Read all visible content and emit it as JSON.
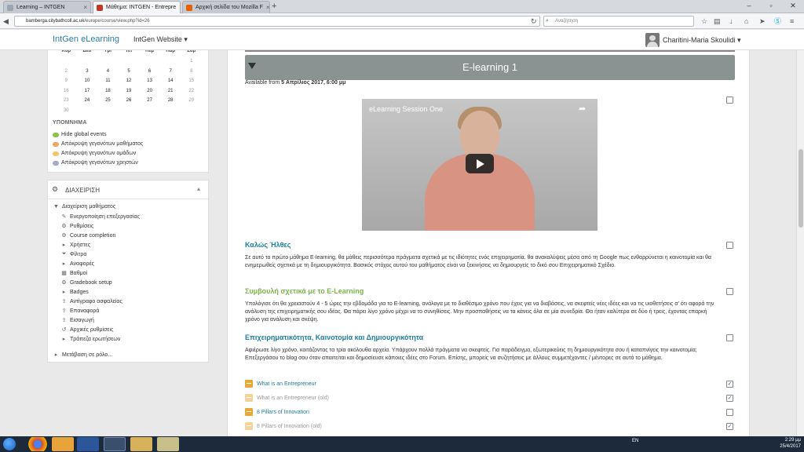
{
  "browser": {
    "tabs": [
      {
        "label": "Learning – INTGEN",
        "favicon_color": "#9aa6b3"
      },
      {
        "label": "Μάθημα: INTGEN - Entrepre",
        "favicon_color": "#c0392b"
      },
      {
        "label": "Αρχική σελίδα του Mozilla F",
        "favicon_color": "#e66000"
      }
    ],
    "url_host": "bamberga.citybathcoll.ac.uk",
    "url_path": "/europe/course/view.php?id=26",
    "search_placeholder": "Αναζήτηση"
  },
  "header": {
    "brand": "IntGen eLearning",
    "site_menu": "IntGen Website",
    "user_name": "Charitini-Maria Skoulidi"
  },
  "calendar": {
    "weekdays": [
      "Κυρ",
      "Δευ",
      "Τρι",
      "Τετ",
      "Πεμ",
      "Παρ",
      "Σαβ"
    ],
    "weeks": [
      [
        "",
        "",
        "",
        "",
        "",
        "",
        "1"
      ],
      [
        "2",
        "3",
        "4",
        "5",
        "6",
        "7",
        "8"
      ],
      [
        "9",
        "10",
        "11",
        "12",
        "13",
        "14",
        "15"
      ],
      [
        "16",
        "17",
        "18",
        "19",
        "20",
        "21",
        "22"
      ],
      [
        "23",
        "24",
        "25",
        "26",
        "27",
        "28",
        "29"
      ],
      [
        "30",
        "",
        "",
        "",
        "",
        "",
        ""
      ]
    ],
    "legend_title": "ΥΠΟΜΝΗΜΑ",
    "legend": [
      {
        "label": "Hide global events",
        "color": "#8bc34a"
      },
      {
        "label": "Απόκρυψη γεγονότων μαθήματος",
        "color": "#f0a860"
      },
      {
        "label": "Απόκρυψη γεγονότων ομάδων",
        "color": "#f6c46a"
      },
      {
        "label": "Απόκρυψη γεγονότων χρηστών",
        "color": "#a3a9c9"
      }
    ]
  },
  "admin": {
    "title": "ΔΙΑΧΕΙΡΙΣΗ",
    "course_admin": "Διαχείριση μαθήματος",
    "items": [
      {
        "label": "Ενεργοποίηση επεξεργασίας",
        "icon": "pencil-icon"
      },
      {
        "label": "Ρυθμίσεις",
        "icon": "gear-icon"
      },
      {
        "label": "Course completion",
        "icon": "gear-icon"
      },
      {
        "label": "Χρήστες",
        "icon": "caret-right-icon"
      },
      {
        "label": "Φίλτρα",
        "icon": "filter-icon"
      },
      {
        "label": "Αναφορές",
        "icon": "caret-right-icon"
      },
      {
        "label": "Βαθμοί",
        "icon": "grades-icon"
      },
      {
        "label": "Gradebook setup",
        "icon": "gear-icon"
      },
      {
        "label": "Badges",
        "icon": "caret-right-icon"
      },
      {
        "label": "Αντίγραφο ασφαλείας",
        "icon": "upload-icon"
      },
      {
        "label": "Επαναφορά",
        "icon": "upload-icon"
      },
      {
        "label": "Εισαγωγή",
        "icon": "upload-icon"
      },
      {
        "label": "Αρχικές ρυθμίσεις",
        "icon": "reset-icon"
      },
      {
        "label": "Τράπεζα ερωτήσεων",
        "icon": "caret-right-icon"
      }
    ],
    "switch_role": "Μετάβαση σε ρόλο..."
  },
  "section": {
    "title": "E-learning 1",
    "availability_prefix": "Available from ",
    "availability_date": "5 Απρίλιος 2017, 6:00 μμ"
  },
  "video": {
    "title": "eLearning Session One"
  },
  "activities": [
    {
      "title": "Καλώς Ήλθες",
      "title_color": "#1b7ea0",
      "text": "Σε αυτό το πρώτο μάθημα E-learning, θα μάθεις περισσότερα πράγματα σχετικά με τις ιδιότητες ενός επιχειρηματία. θα ανακαλύψεις μέσα από τη Google πως ενθαρρύνεται η καινοτομία και θα ενημερωθείς σχετικά με τη δημιουργικότητα. Βασικός στόχος αυτού του μαθήματος είναι να ξεκινήσεις να δημιουργείς το δικό σου Επιχειρηματικό Σχέδιο."
    },
    {
      "title": "Συμβουλή σχετικά με το E-Learning",
      "title_color": "#7ab648",
      "text": "Υπολόγισε ότι θα χρειαστούν 4 - 5 ώρες την εβδομάδα για το E-learning, ανάλογα με το διαθέσιμο χρόνο που έχεις για να διαβάσεις, να σκεφτείς νέες ιδέες και να τις υιοθετήσεις σ' ότι αφορά την ανάλυση της επιχειρηματικής σου ιδέας. Θα πάρει λίγο χρόνο μέχρι να το συνηθίσεις. Μην προσπαθήσεις να τα κάνεις όλα σε μία συνεδρία. Θα ήταν καλύτερα σε δύο ή τρεις, έχοντας επαρκή χρόνο για ανάλυση και σκέψη."
    },
    {
      "title": "Επιχειρηματικότητα, Καινοτομία και Δημιουργικότητα",
      "title_color": "#1b7ea0",
      "text": "Αφιέρωσε λίγο χρόνο, κοιτάζοντας τα τρία ακόλουθα αρχεία. Υπάρχουν πολλά πράγματα να σκεφτείς. Για παράδειγμα, εξωτερικεύεις τη δημιουργικότητα σου ή καταπνίγεις την καινοτομία; Επεξεργάσου το blog σου όταν απαιτείται και δημοσίευσε κάποιες ιδέες στο Forum. Επίσης, μπορείς να συζητήσεις με άλλους συμμετέχοντες / μέντορες σε αυτό το μάθημα."
    }
  ],
  "resources": [
    {
      "label": "What is an Entrepreneur",
      "faded": false,
      "checked": true
    },
    {
      "label": "What is an Entrepreneur (old)",
      "faded": true,
      "checked": true
    },
    {
      "label": "8 Pillars of Innovation",
      "faded": false,
      "checked": false
    },
    {
      "label": "8 Pillars of Innovation (old)",
      "faded": true,
      "checked": true
    }
  ],
  "taskbar": {
    "lang": "EN",
    "time": "2:29 μμ",
    "date": "25/4/2017"
  }
}
